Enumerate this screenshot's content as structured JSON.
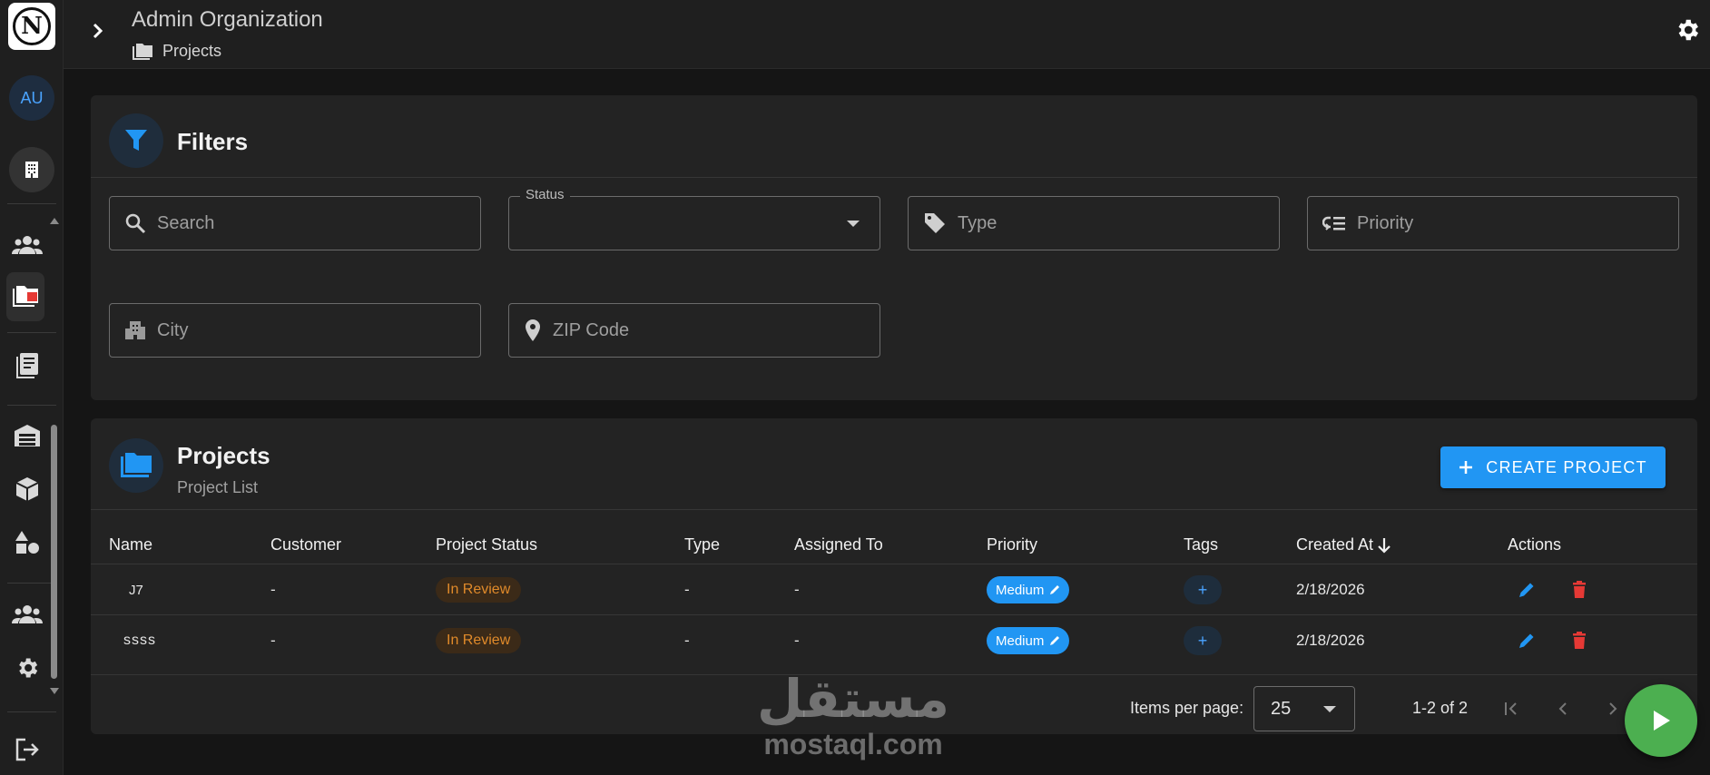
{
  "topbar": {
    "org_title": "Admin Organization",
    "breadcrumb": "Projects",
    "icons": [
      "chevron-right-icon",
      "folder-icon",
      "gear-icon"
    ]
  },
  "sidebar": {
    "avatar_initials": "AU",
    "items": [
      {
        "name": "users-icon"
      },
      {
        "name": "projects-icon"
      },
      {
        "name": "documents-icon"
      },
      {
        "name": "warehouse-icon"
      },
      {
        "name": "package-icon"
      },
      {
        "name": "shapes-icon"
      },
      {
        "name": "team-icon"
      },
      {
        "name": "settings-icon"
      },
      {
        "name": "logout-icon"
      }
    ]
  },
  "filters": {
    "title": "Filters",
    "search_placeholder": "Search",
    "status_label": "Status",
    "status_value": "",
    "type_placeholder": "Type",
    "priority_placeholder": "Priority",
    "city_placeholder": "City",
    "zip_placeholder": "ZIP Code"
  },
  "projects": {
    "title": "Projects",
    "subtitle": "Project List",
    "create_label": "CREATE PROJECT",
    "columns": [
      "Name",
      "Customer",
      "Project Status",
      "Type",
      "Assigned To",
      "Priority",
      "Tags",
      "Created At",
      "Actions"
    ],
    "rows": [
      {
        "name": "J7",
        "customer": "-",
        "status": "In Review",
        "type": "-",
        "assigned_to": "-",
        "priority": "Medium",
        "tags_add": "+",
        "created_at": "2/18/2026"
      },
      {
        "name": "ssss",
        "customer": "-",
        "status": "In Review",
        "type": "-",
        "assigned_to": "-",
        "priority": "Medium",
        "tags_add": "+",
        "created_at": "2/18/2026"
      }
    ],
    "footer": {
      "items_per_page_label": "Items per page:",
      "items_per_page": "25",
      "range": "1-2 of 2"
    }
  },
  "watermark": {
    "arabic": "مستقل",
    "latin": "mostaql.com"
  },
  "colors": {
    "accent": "#2196f3",
    "status_text": "#e08a2a",
    "delete": "#e53935",
    "fab": "#4caf50"
  }
}
